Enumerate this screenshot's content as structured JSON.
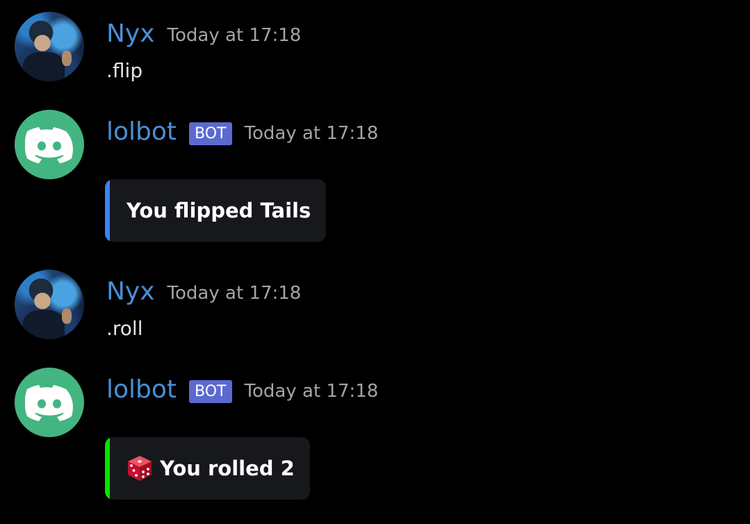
{
  "messages": [
    {
      "author": "Nyx",
      "timestamp": "Today at 17:18",
      "text": ".flip"
    },
    {
      "author": "lolbot",
      "bot_tag": "BOT",
      "timestamp": "Today at 17:18",
      "embed": {
        "title": "You flipped Tails",
        "accent_color": "#3b82f6"
      }
    },
    {
      "author": "Nyx",
      "timestamp": "Today at 17:18",
      "text": ".roll"
    },
    {
      "author": "lolbot",
      "bot_tag": "BOT",
      "timestamp": "Today at 17:18",
      "embed": {
        "icon": "dice-icon",
        "title": "You rolled 2",
        "accent_color": "#00e600"
      }
    }
  ],
  "colors": {
    "background": "#000000",
    "username": "#4a8fd6",
    "bot_tag": "#5b6ad0",
    "bot_avatar": "#43b581",
    "embed_background": "#17181c"
  }
}
